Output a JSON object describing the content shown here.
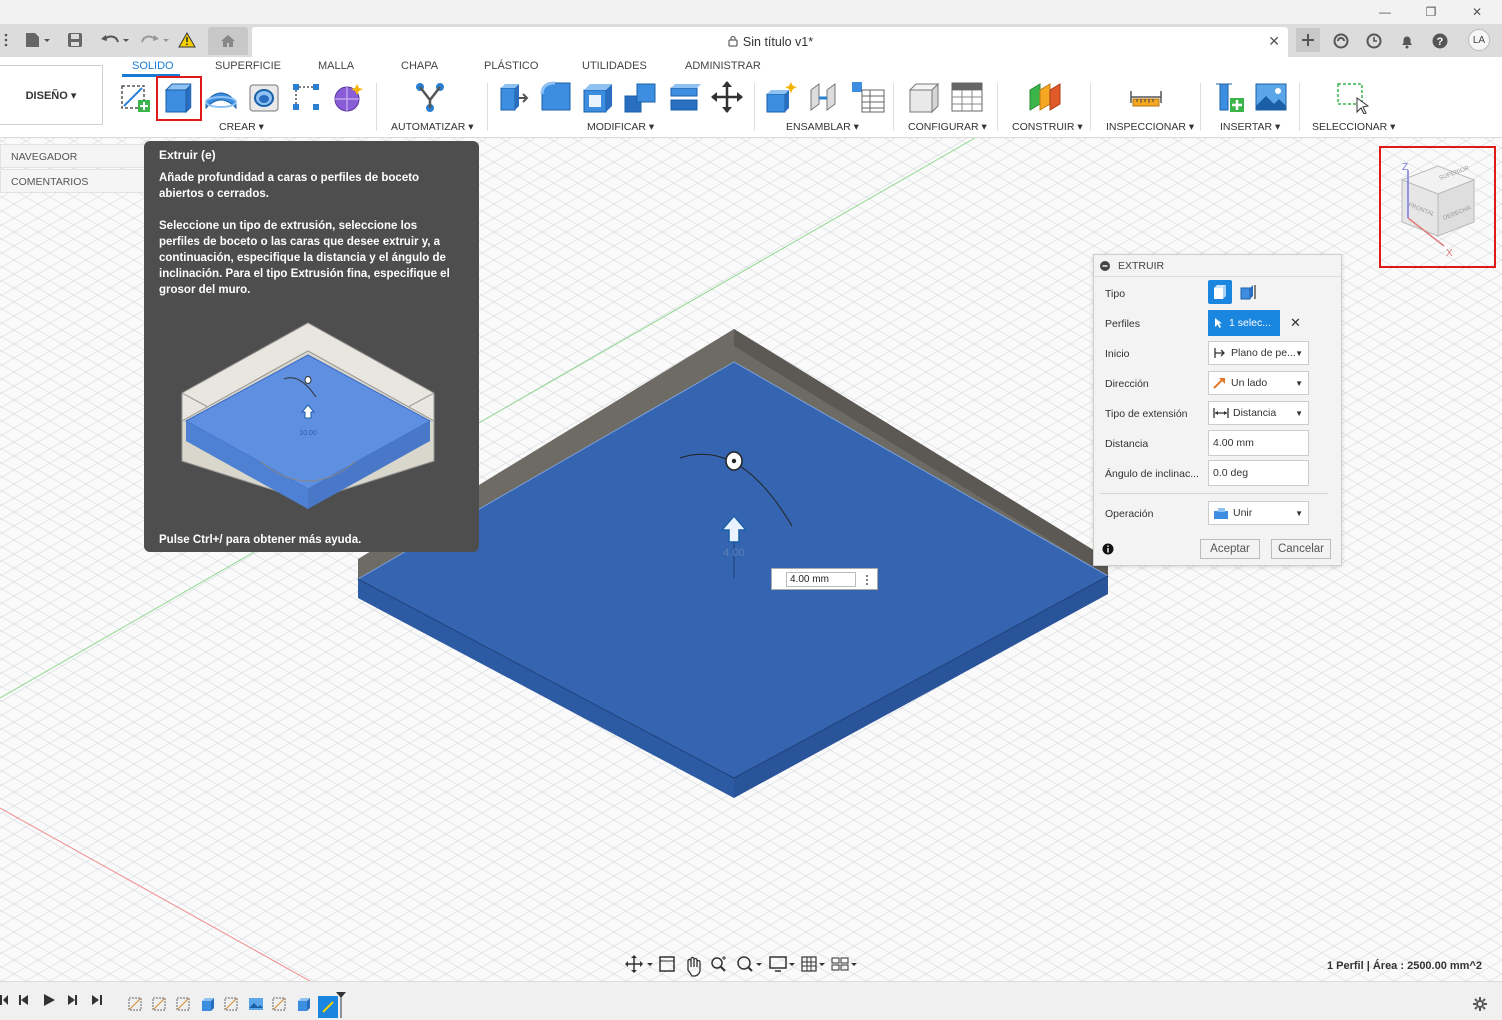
{
  "window": {
    "minimize": "—",
    "restore": "❐",
    "close": "✕"
  },
  "document": {
    "title": "Sin título v1*",
    "close": "✕"
  },
  "user": {
    "initials": "LA"
  },
  "workspace": {
    "label": "DISEÑO ▾"
  },
  "ribbon_tabs": [
    {
      "label": "SOLIDO",
      "active": true
    },
    {
      "label": "SUPERFICIE"
    },
    {
      "label": "MALLA"
    },
    {
      "label": "CHAPA"
    },
    {
      "label": "PLÁSTICO"
    },
    {
      "label": "UTILIDADES"
    },
    {
      "label": "ADMINISTRAR"
    }
  ],
  "ribbon_groups": {
    "crear": "CREAR ▾",
    "automatizar": "AUTOMATIZAR ▾",
    "modificar": "MODIFICAR ▾",
    "ensamblar": "ENSAMBLAR ▾",
    "configurar": "CONFIGURAR ▾",
    "construir": "CONSTRUIR ▾",
    "inspeccionar": "INSPECCIONAR ▾",
    "insertar": "INSERTAR ▾",
    "seleccionar": "SELECCIONAR ▾"
  },
  "browser": {
    "navigator": "NAVEGADOR",
    "comments": "COMENTARIOS"
  },
  "tooltip": {
    "title": "Extruir (e)",
    "p1": "Añade profundidad a caras o perfiles de boceto abiertos o cerrados.",
    "p2": "Seleccione un tipo de extrusión, seleccione los perfiles de boceto o las caras que desee extruir y, a continuación, especifique la distancia y el ángulo de inclinación. Para el tipo Extrusión fina, especifique el grosor del muro.",
    "illustration_value": "10.00",
    "footer": "Pulse Ctrl+/ para obtener más ayuda."
  },
  "dialog": {
    "title": "EXTRUIR",
    "tipo_label": "Tipo",
    "perfiles_label": "Perfiles",
    "perfiles_value": "1 selec...",
    "clear": "✕",
    "inicio_label": "Inicio",
    "inicio_value": "Plano de pe...",
    "direccion_label": "Dirección",
    "direccion_value": "Un lado",
    "extension_label": "Tipo de extensión",
    "extension_value": "Distancia",
    "distancia_label": "Distancia",
    "distancia_value": "4.00 mm",
    "angulo_label": "Ángulo de inclinac...",
    "angulo_value": "0.0 deg",
    "operacion_label": "Operación",
    "operacion_value": "Unir",
    "ok": "Aceptar",
    "cancel": "Cancelar"
  },
  "canvas": {
    "dim_label": "4.00",
    "dim_input": "4.00 mm"
  },
  "viewcube": {
    "front": "FRONTAL",
    "right": "DERECHA",
    "top": "SUPERIOR",
    "x": "X",
    "z": "Z"
  },
  "status": {
    "text": "1 Perfil | Área : 2500.00 mm^2"
  },
  "colors": {
    "accent": "#1a7bd6",
    "body_blue": "#3565b0",
    "highlight_red": "#e01818"
  }
}
